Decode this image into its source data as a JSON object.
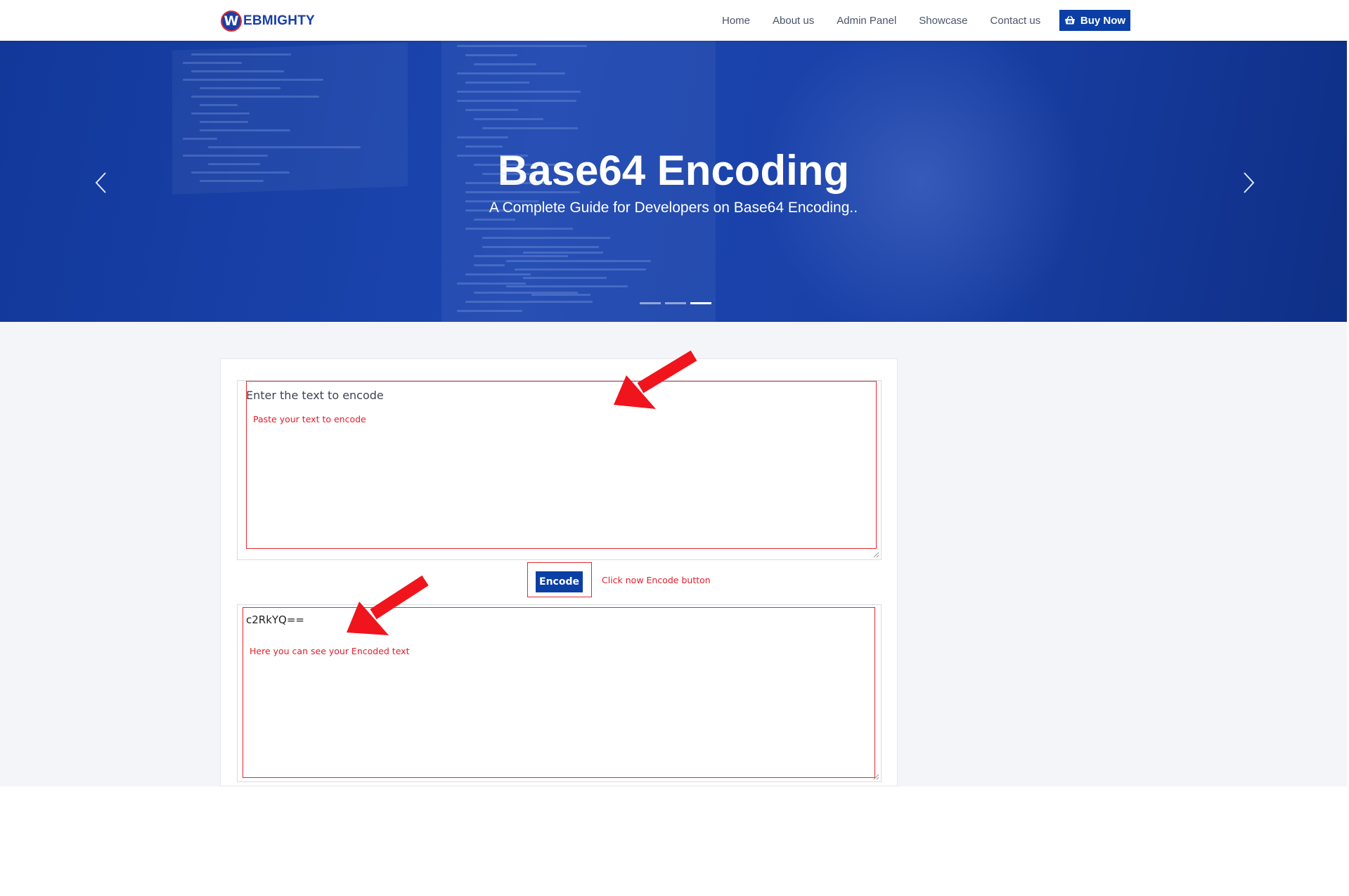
{
  "brand": {
    "mark": "W",
    "name": "EBMIGHTY"
  },
  "nav": {
    "links": [
      "Home",
      "About us",
      "Admin Panel",
      "Showcase",
      "Contact us"
    ],
    "buy_label": "Buy Now"
  },
  "hero": {
    "title": "Base64 Encoding",
    "subtitle": "A Complete Guide for Developers on Base64 Encoding..",
    "slides": 3,
    "active_slide": 3
  },
  "encoder": {
    "input_placeholder": "Enter the text to encode",
    "input_value": "",
    "output_value": "c2RkYQ==",
    "encode_label": "Encode"
  },
  "annotations": {
    "input_note": "Paste your text to encode",
    "button_note": "Click now Encode  button",
    "output_note": "Here you can see your Encoded text"
  },
  "colors": {
    "primary": "#0b3fa6",
    "annotation_red": "#e8282f",
    "page_bg": "#f3f5f9"
  }
}
